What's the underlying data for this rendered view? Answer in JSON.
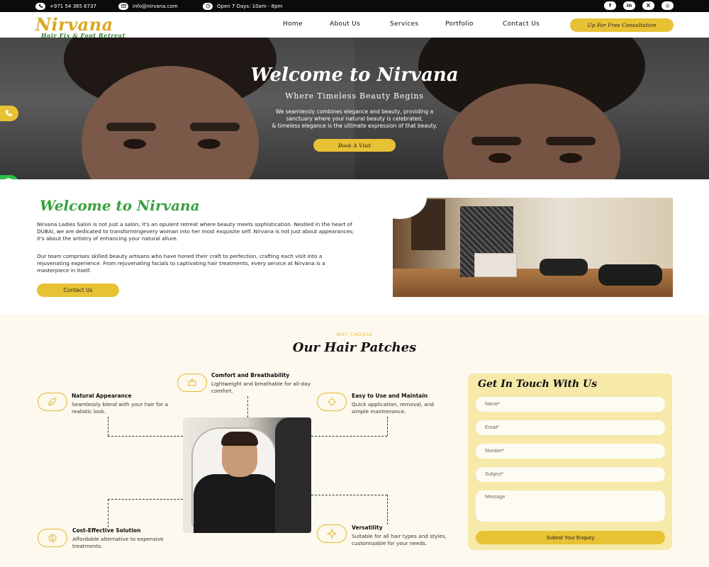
{
  "topbar": {
    "phone": "+971 54 365 6737",
    "email": "info@nirvana.com",
    "hours": "Open 7 Days: 10am - 8pm",
    "social": [
      {
        "icon": "facebook-icon",
        "glyph": "f"
      },
      {
        "icon": "linkedin-icon",
        "glyph": "in"
      },
      {
        "icon": "x-twitter-icon",
        "glyph": "X"
      },
      {
        "icon": "instagram-icon",
        "glyph": "◎"
      }
    ]
  },
  "brand": {
    "name": "Nirvana",
    "tagline": "Hair Fix & Foot Retreat"
  },
  "nav": {
    "links": [
      "Home",
      "About Us",
      "Services",
      "Portfolio",
      "Contact Us"
    ],
    "cta": "Up For Free Consultation"
  },
  "hero": {
    "title": "Welcome to Nirvana",
    "subtitle": "Where Timeless Beauty Begins",
    "line1": "We seamlessly combines elegance and beauty, providing a",
    "line2": "sanctuary where your natural beauty is celebrated,",
    "line3": "& timeless elegance is the ultimate expression of that beauty.",
    "button": "Book A Visit"
  },
  "welcome": {
    "title": "Welcome to Nirvana",
    "para1": "Nirvana Ladies Salon is not just a salon; it's an opulent retreat where beauty meets sophistication. Nestled in the heart of DUBAI, we are dedicated to transformingevery woman into her most exquisite self. Nirvana is not just about appearances; it's about the artistry of enhancing your natural allure.",
    "para2": "Our team comprises skilled beauty artisans who have honed their craft to perfection, crafting each visit into a rejuvenating experience. From rejuvenating facials to captivating hair treatments, every service at Nirvana is a masterpiece in itself.",
    "button": "Contact Us"
  },
  "why": {
    "kicker": "WHY CHOOSE",
    "title": "Our Hair Patches",
    "features": [
      {
        "title": "Natural Appearance",
        "desc": "Seamlessly blend with your hair for a realistic look."
      },
      {
        "title": "Comfort and Breathability",
        "desc": "Lightweight and breathable for all-day comfort."
      },
      {
        "title": "Easy to Use and Maintain",
        "desc": "Quick application, removal, and simple maintenance."
      },
      {
        "title": "Cost-Effective Solution",
        "desc": "Affordable alternative to expensive treatments."
      },
      {
        "title": "Versatility",
        "desc": "Suitable for all hair types and styles, customizable for your needs."
      }
    ]
  },
  "form": {
    "title": "Get In Touch With Us",
    "name_ph": "Name*",
    "email_ph": "Email*",
    "number_ph": "Number*",
    "subject_ph": "Subject*",
    "message_ph": "Message",
    "submit": "Submit Your Enquiry"
  },
  "colors": {
    "accent": "#e8c235",
    "brand_green": "#39a13e",
    "whatsapp": "#28c045",
    "cream": "#fdf9ee"
  }
}
